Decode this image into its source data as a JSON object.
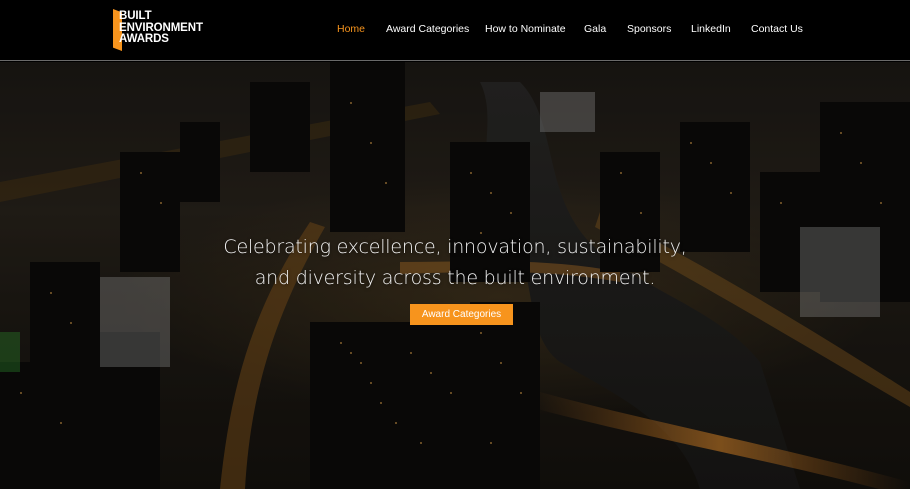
{
  "brand": {
    "logo_lines": [
      "BUILT",
      "ENVIRONMENT",
      "AWARDS"
    ],
    "accent_color": "#f7941d"
  },
  "nav": {
    "items": [
      {
        "label": "Home",
        "active": true
      },
      {
        "label": "Award Categories",
        "active": false
      },
      {
        "label": "How to Nominate",
        "active": false
      },
      {
        "label": "Gala",
        "active": false
      },
      {
        "label": "Sponsors",
        "active": false
      },
      {
        "label": "LinkedIn",
        "active": false
      },
      {
        "label": "Contact Us",
        "active": false
      }
    ]
  },
  "hero": {
    "headline_line1": "Celebrating excellence, innovation, sustainability,",
    "headline_line2": "and diversity across the built environment.",
    "cta_label": "Award Categories",
    "background": "aerial-city-night-photo"
  }
}
